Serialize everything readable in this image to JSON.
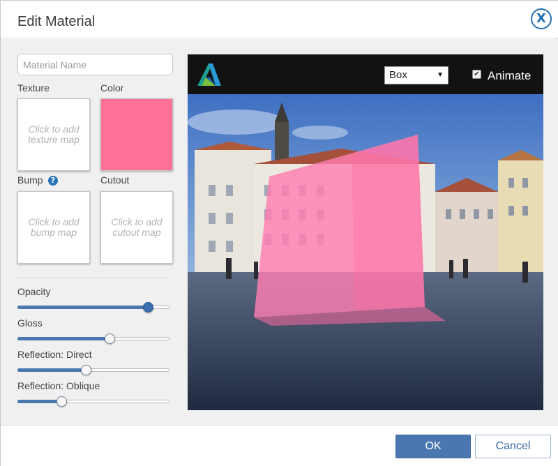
{
  "dialog": {
    "title": "Edit Material",
    "close_icon": "close-icon",
    "close_label": "X"
  },
  "material": {
    "name_value": "",
    "name_placeholder": "Material Name",
    "texture_label": "Texture",
    "texture_placeholder": "Click to add texture map",
    "color_label": "Color",
    "color_value": "#ff7097",
    "bump_label": "Bump",
    "bump_help_icon": "help-icon",
    "bump_help_glyph": "?",
    "bump_placeholder": "Click to add bump map",
    "cutout_label": "Cutout",
    "cutout_placeholder": "Click to add cutout map"
  },
  "sliders": [
    {
      "label": "Opacity",
      "value": 0.856,
      "thumb_style": "dark"
    },
    {
      "label": "Gloss",
      "value": 0.605,
      "thumb_style": "light"
    },
    {
      "label": "Reflection: Direct",
      "value": 0.45,
      "thumb_style": "light"
    },
    {
      "label": "Reflection: Oblique",
      "value": 0.289,
      "thumb_style": "light"
    }
  ],
  "preview": {
    "logo_icon": "autodesk-logo-icon",
    "shape_options": [
      "Box"
    ],
    "shape_selected": "Box",
    "animate_label": "Animate",
    "animate_checked": true,
    "animate_check_glyph": "✔"
  },
  "footer": {
    "ok_label": "OK",
    "cancel_label": "Cancel"
  },
  "colors": {
    "accent": "#4a77b0",
    "close_icon": "#1f6fb2",
    "material_pink": "#ff7097",
    "help_icon": "#2b73b9"
  }
}
